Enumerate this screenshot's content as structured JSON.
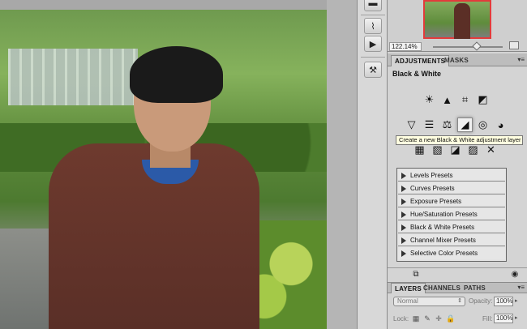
{
  "navigator": {
    "zoom": "122.14%"
  },
  "adjustments": {
    "tabs": [
      "ADJUSTMENTS",
      "MASKS"
    ],
    "panel_title": "Black & White",
    "tooltip": "Create a new Black & White adjustment layer",
    "icons_row1": [
      "brightness-icon",
      "levels-icon",
      "curves-icon",
      "exposure-icon"
    ],
    "icons_row2": [
      "vibrance-icon",
      "hue-saturation-icon",
      "color-balance-icon",
      "black-white-icon",
      "photo-filter-icon",
      "channel-mixer-icon"
    ],
    "presets": [
      "Levels Presets",
      "Curves Presets",
      "Exposure Presets",
      "Hue/Saturation Presets",
      "Black & White Presets",
      "Channel Mixer Presets",
      "Selective Color Presets"
    ]
  },
  "layers": {
    "tabs": [
      "LAYERS",
      "CHANNELS",
      "PATHS"
    ],
    "blend_mode": "Normal",
    "opacity_label": "Opacity:",
    "opacity_value": "100%",
    "lock_label": "Lock:",
    "fill_label": "Fill:",
    "fill_value": "100%"
  }
}
